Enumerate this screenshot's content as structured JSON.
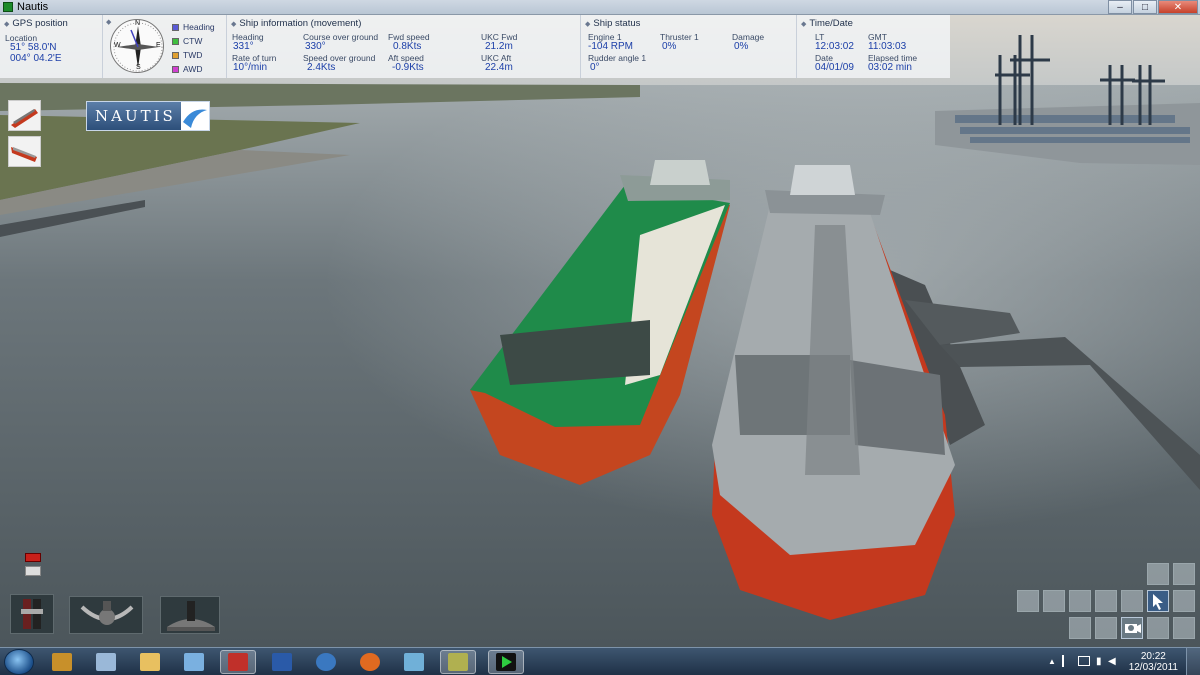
{
  "window": {
    "title": "Nautis",
    "minimize": "–",
    "maximize": "□",
    "close": "✕"
  },
  "hud": {
    "gps": {
      "title": "GPS position",
      "location_label": "Location",
      "lat": "51° 58.0'N",
      "lon": "004° 04.2'E"
    },
    "compass": {
      "north": "N",
      "south": "S",
      "east": "E",
      "west": "W"
    },
    "legend": [
      {
        "label": "Heading",
        "color": "#5b5bd6"
      },
      {
        "label": "CTW",
        "color": "#3fbf3f"
      },
      {
        "label": "TWD",
        "color": "#e0a030"
      },
      {
        "label": "AWD",
        "color": "#d040d0"
      }
    ],
    "ship_info": {
      "title": "Ship information (movement)",
      "heading_label": "Heading",
      "heading": "331°",
      "rot_label": "Rate of turn",
      "rot": "10°/min",
      "cog_label": "Course over ground",
      "cog": "330°",
      "sog_label": "Speed over ground",
      "sog": "2.4Kts",
      "fwd_label": "Fwd speed",
      "fwd": "0.8Kts",
      "aft_label": "Aft speed",
      "aft": "-0.9Kts",
      "ukc_fwd_label": "UKC Fwd",
      "ukc_fwd": "21.2m",
      "ukc_aft_label": "UKC Aft",
      "ukc_aft": "22.4m"
    },
    "ship_status": {
      "title": "Ship status",
      "engine_label": "Engine 1",
      "engine": "-104 RPM",
      "rudder_label": "Rudder angle 1",
      "rudder": "0°",
      "thruster_label": "Thruster 1",
      "thruster": "0%",
      "damage_label": "Damage",
      "damage": "0%"
    },
    "time": {
      "title": "Time/Date",
      "lt_label": "LT",
      "lt": "12:03:02",
      "gmt_label": "GMT",
      "gmt": "11:03:03",
      "date_label": "Date",
      "date": "04/01/09",
      "elapsed_label": "Elapsed time",
      "elapsed": "03:02 min"
    }
  },
  "logo": {
    "text": "NAUTIS"
  },
  "taskbar": {
    "time": "20:22",
    "date": "12/03/2011",
    "apps": [
      {
        "name": "fire-brigade",
        "color": "#c8902a"
      },
      {
        "name": "notepad",
        "color": "#9ab8d8"
      },
      {
        "name": "explorer",
        "color": "#e8c060"
      },
      {
        "name": "paint",
        "color": "#7ab0e0"
      },
      {
        "name": "acrobat",
        "color": "#c0302a"
      },
      {
        "name": "word",
        "color": "#2a5aa8"
      },
      {
        "name": "thunderbird",
        "color": "#3a78c0"
      },
      {
        "name": "firefox",
        "color": "#e06a20"
      },
      {
        "name": "editor",
        "color": "#70b0d8"
      },
      {
        "name": "nautis-tool",
        "color": "#b0b050"
      },
      {
        "name": "nautis-play",
        "color": "#1c8a2a"
      }
    ]
  }
}
